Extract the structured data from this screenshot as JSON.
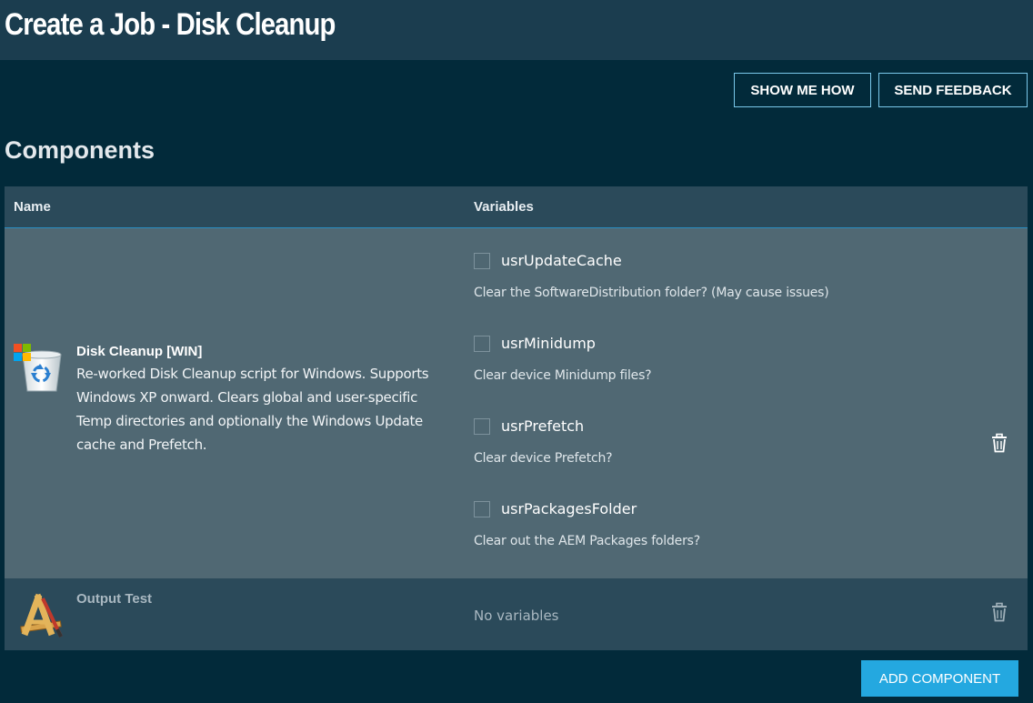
{
  "header": {
    "title": "Create a Job - Disk Cleanup"
  },
  "toolbar": {
    "show_me_how": "SHOW ME HOW",
    "send_feedback": "SEND FEEDBACK"
  },
  "section": {
    "title": "Components"
  },
  "table": {
    "columns": {
      "name": "Name",
      "variables": "Variables"
    },
    "rows": [
      {
        "name": "Disk Cleanup [WIN]",
        "description": "Re-worked Disk Cleanup script for Windows. Supports Windows XP onward. Clears global and user-specific Temp directories and optionally the Windows Update cache and Prefetch.",
        "icon": "recycle-bin-windows-icon",
        "variables": [
          {
            "label": "usrUpdateCache",
            "description": "Clear the SoftwareDistribution folder? (May cause issues)",
            "checked": false
          },
          {
            "label": "usrMinidump",
            "description": "Clear device Minidump files?",
            "checked": false
          },
          {
            "label": "usrPrefetch",
            "description": "Clear device Prefetch?",
            "checked": false
          },
          {
            "label": "usrPackagesFolder",
            "description": "Clear out the AEM Packages folders?",
            "checked": false
          }
        ]
      },
      {
        "name": "Output Test",
        "description": "",
        "icon": "developer-tools-icon",
        "no_variables": "No variables"
      }
    ]
  },
  "footer": {
    "add_component": "ADD COMPONENT"
  },
  "colors": {
    "background": "#022a3a",
    "titlebar": "#1b3d4f",
    "accent": "#24a8e0",
    "row_selected": "#506873",
    "row_default": "#2b4a5a"
  }
}
